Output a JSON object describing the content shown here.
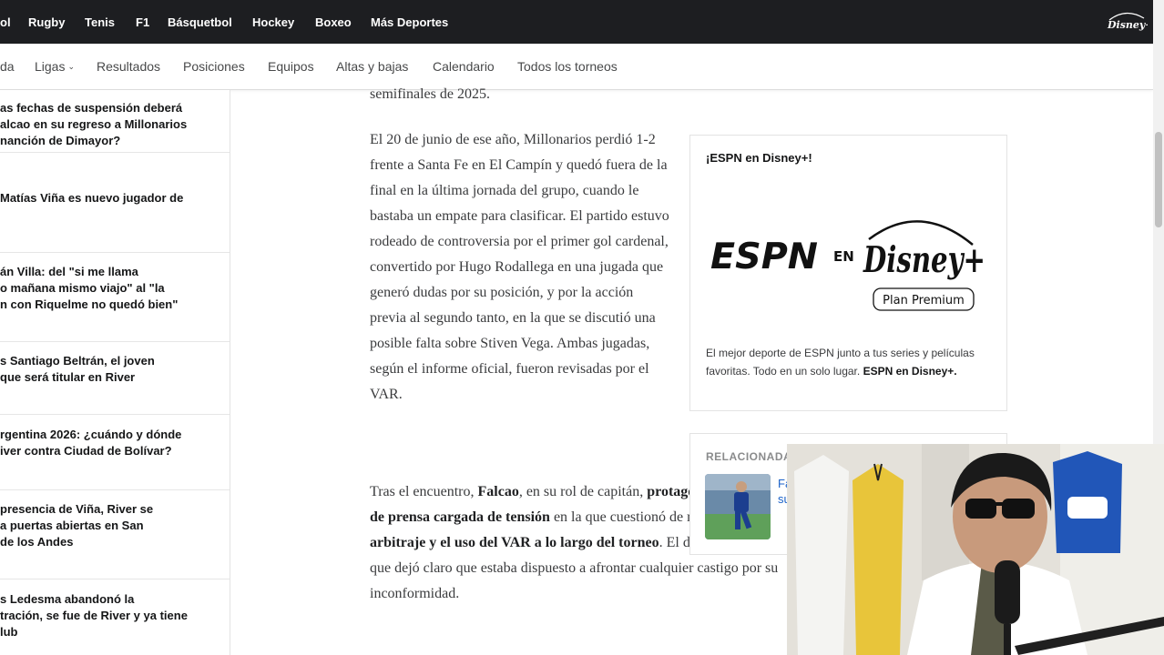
{
  "top_nav": {
    "items": [
      "ol",
      "Rugby",
      "Tenis",
      "F1",
      "Básquetbol",
      "Hockey",
      "Boxeo",
      "Más Deportes"
    ],
    "logo_text": "Disney+"
  },
  "sub_nav": {
    "items": [
      "da",
      "Ligas",
      "Resultados",
      "Posiciones",
      "Equipos",
      "Altas y bajas",
      "Calendario",
      "Todos los torneos"
    ]
  },
  "sidebar": {
    "headlines": [
      {
        "lines": [
          "as fechas de suspensión deberá",
          "alcao en su regreso a Millonarios",
          "nanción de Dimayor?"
        ]
      },
      {
        "lines": [
          "Matías Viña es nuevo jugador de"
        ]
      },
      {
        "lines": [
          "án Villa: del \"si me llama",
          "o mañana mismo viajo\" al \"la",
          "n con Riquelme no quedó bien\""
        ]
      },
      {
        "lines": [
          "s Santiago Beltrán, el joven",
          "que será titular en River"
        ]
      },
      {
        "lines": [
          "rgentina 2026: ¿cuándo y dónde",
          "iver contra Ciudad de Bolívar?"
        ]
      },
      {
        "lines": [
          "presencia de Viña, River se",
          "a puertas abiertas en San",
          "de los Andes"
        ]
      },
      {
        "lines": [
          "s Ledesma abandonó la",
          "tración, se fue de River y ya tiene",
          "lub"
        ]
      }
    ]
  },
  "article": {
    "p0": "semifinales de 2025.",
    "p1": "El 20 de junio de ese año, Millonarios perdió 1-2 frente a Santa Fe en El Campín y quedó fuera de la final en la última jornada del grupo, cuando le bastaba un empate para clasificar. El partido estuvo rodeado de controversia por el primer gol cardenal, convertido por Hugo Rodallega en una jugada que generó dudas por su posición, y por la acción previa al segundo tanto, en la que se discutió una posible falta sobre Stiven Vega. Ambas jugadas, según el informe oficial, fueron revisadas por el VAR.",
    "p2": {
      "t1": "Tras el encuentro, ",
      "b1": "Falcao",
      "t2": ", en su rol de capitán, ",
      "b2": "protagonizó una rueda de prensa cargada de tensión",
      "t3": " en la que cuestionó de manera frontal el ",
      "b3": "arbitraje y el uso del VAR a lo largo del torneo",
      "t4": ". El delantero aseguró que dejó claro que estaba dispuesto a afrontar cualquier castigo por su inconformidad."
    }
  },
  "promo": {
    "title": "¡ESPN en Disney+!",
    "espn_text": "ESPN",
    "en_text": "EN",
    "disney_text": "Disney+",
    "plan_text": "Plan Premium",
    "desc": "El mejor deporte de ESPN junto a tus series y películas favoritas. Todo en un solo lugar.",
    "desc_bold": "ESPN en Disney+."
  },
  "related": {
    "title": "RELACIONADA",
    "link_line1": "Fa",
    "link_line2": "su"
  },
  "colors": {
    "top_nav_bg": "#1d1e21",
    "link_blue": "#1b62c9",
    "text_dark": "#151617"
  }
}
